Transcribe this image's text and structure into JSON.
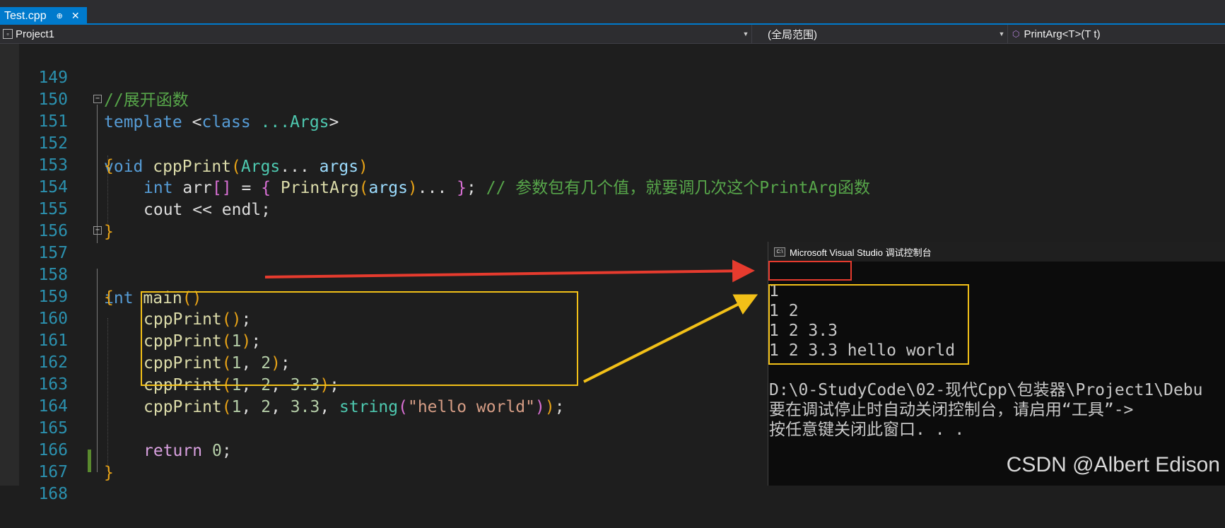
{
  "tab": {
    "filename": "Test.cpp",
    "pin_glyph": "⊕",
    "close_glyph": "✕"
  },
  "navbar": {
    "project": "Project1",
    "scope": "(全局范围)",
    "member": "PrintArg<T>(T t)"
  },
  "editor": {
    "lines": [
      {
        "n": "149"
      },
      {
        "n": "150"
      },
      {
        "n": "151"
      },
      {
        "n": "152"
      },
      {
        "n": "153"
      },
      {
        "n": "154"
      },
      {
        "n": "155"
      },
      {
        "n": "156"
      },
      {
        "n": "157"
      },
      {
        "n": "158"
      },
      {
        "n": "159"
      },
      {
        "n": "160"
      },
      {
        "n": "161"
      },
      {
        "n": "162"
      },
      {
        "n": "163"
      },
      {
        "n": "164"
      },
      {
        "n": "165"
      },
      {
        "n": "166"
      },
      {
        "n": "167"
      },
      {
        "n": "168"
      }
    ],
    "code": {
      "l149_comment": "//展开函数",
      "l150_template": "template",
      "l150_lt": " <",
      "l150_class": "class",
      "l150_args": " ...Args",
      "l150_gt": ">",
      "l151_void": "void",
      "l151_fn": " cppPrint",
      "l151_lp": "(",
      "l151_type": "Args",
      "l151_dots": "... ",
      "l151_param": "args",
      "l151_rp": ")",
      "open_brace": "{",
      "close_brace": "}",
      "l153_int": "int",
      "l153_arr": " arr",
      "l153_brk": "[]",
      "l153_eq": " = ",
      "l153_lb": "{",
      "l153_fn": " PrintArg",
      "l153_lp": "(",
      "l153_args": "args",
      "l153_rp": ")",
      "l153_dots": "... ",
      "l153_rb": "}",
      "l153_semi": "; ",
      "l153_comment": "// 参数包有几个值，就要调几次这个PrintArg函数",
      "l154": "cout << endl;",
      "l157_int": "int",
      "l157_main": " main",
      "l157_parens": "()",
      "cpp_fn": "cppPrint",
      "lp": "(",
      "rp": ")",
      "semi": ";",
      "n1": "1",
      "n2": "2",
      "n33": "3.3",
      "comma": ", ",
      "string_type": "string",
      "hello": "\"hello world\"",
      "l165_return": "return",
      "l165_zero": "0",
      "l165_semi": ";"
    }
  },
  "console": {
    "title": "Microsoft Visual Studio 调试控制台",
    "icon_text": "C:\\",
    "output": [
      "",
      "1",
      "1 2",
      "1 2 3.3",
      "1 2 3.3 hello world",
      "",
      "D:\\0-StudyCode\\02-现代Cpp\\包装器\\Project1\\Debu",
      "要在调试停止时自动关闭控制台，请启用“工具”->",
      "按任意键关闭此窗口. . ."
    ]
  },
  "watermark": "CSDN @Albert Edison",
  "colors": {
    "accent": "#007acc",
    "annotation_yellow": "#f2c018",
    "annotation_red": "#e63b2e"
  }
}
